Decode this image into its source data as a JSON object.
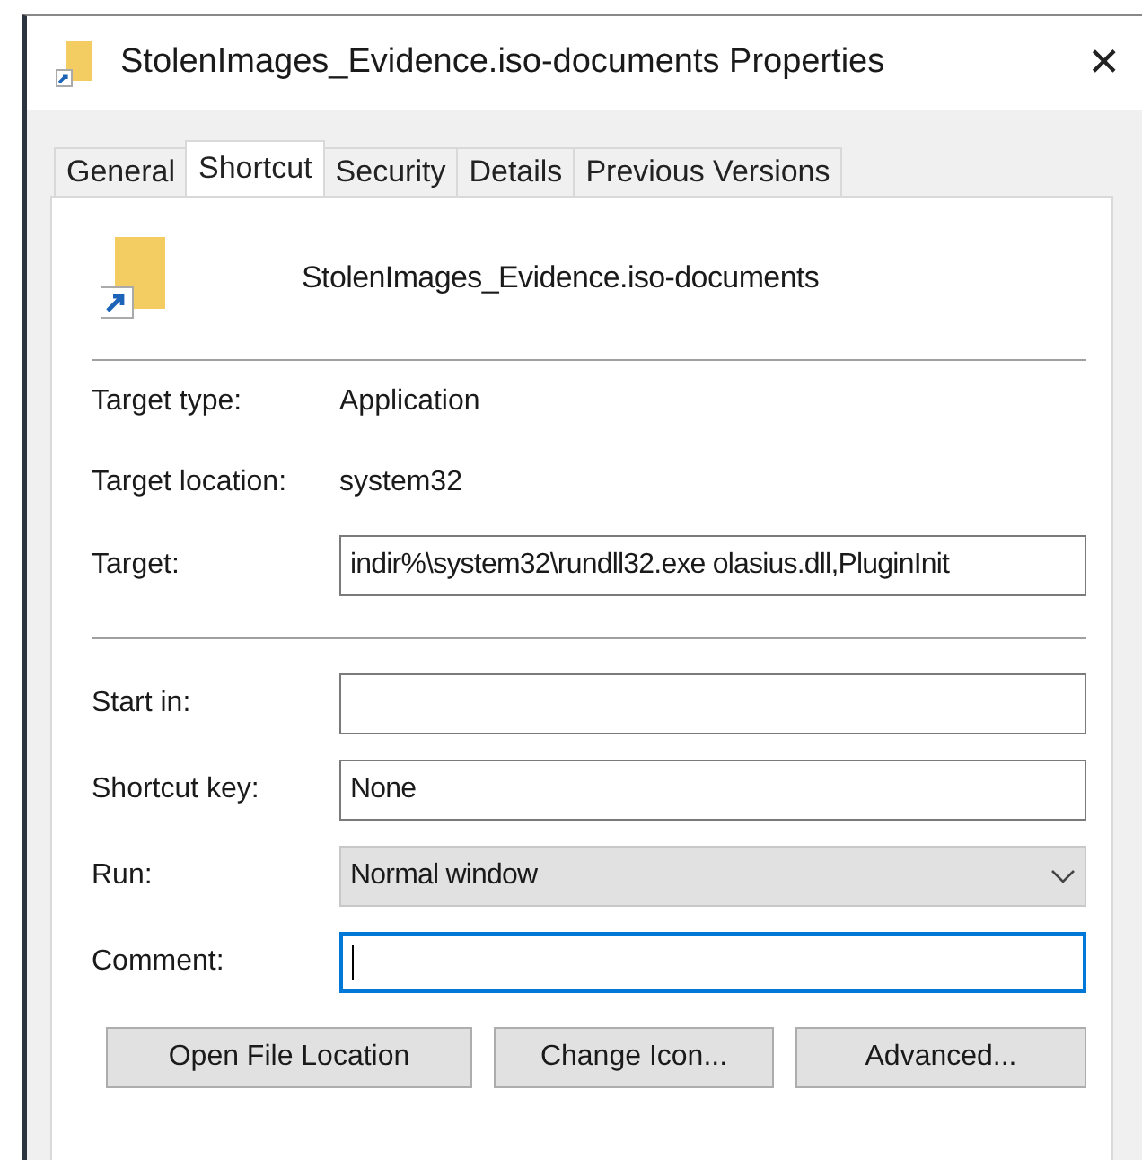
{
  "window": {
    "title": "StolenImages_Evidence.iso-documents Properties",
    "close": "✕"
  },
  "tabs": [
    {
      "label": "General",
      "selected": false
    },
    {
      "label": "Shortcut",
      "selected": true
    },
    {
      "label": "Security",
      "selected": false
    },
    {
      "label": "Details",
      "selected": false
    },
    {
      "label": "Previous Versions",
      "selected": false
    }
  ],
  "shortcut_name": "StolenImages_Evidence.iso-documents",
  "info": [
    {
      "label": "Target type:",
      "value": "Application"
    },
    {
      "label": "Target location:",
      "value": "system32"
    }
  ],
  "target": {
    "label": "Target:",
    "value": "indir%\\system32\\rundll32.exe olasius.dll,PluginInit"
  },
  "fields": [
    {
      "kind": "text",
      "label": "Start in:",
      "focused": false
    },
    {
      "kind": "text",
      "label": "Shortcut key:",
      "value": "None",
      "focused": false
    },
    {
      "kind": "dropdown",
      "label": "Run:",
      "value": "Normal window",
      "focused": false
    },
    {
      "kind": "text",
      "label": "Comment:",
      "focused": true
    }
  ],
  "buttons": [
    "Open File Location",
    "Change Icon...",
    "Advanced..."
  ]
}
